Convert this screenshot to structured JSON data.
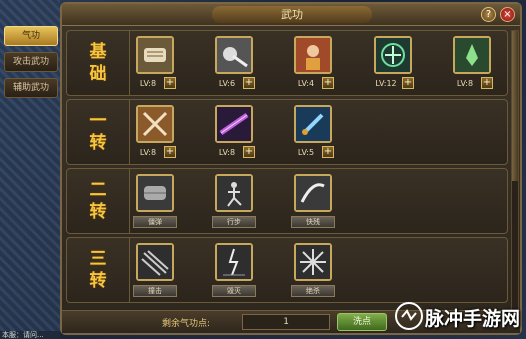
{
  "window": {
    "title": "武功"
  },
  "side_tabs": [
    {
      "label": "气功",
      "active": true
    },
    {
      "label": "攻击武功",
      "active": false
    },
    {
      "label": "辅助武功",
      "active": false
    }
  ],
  "tiers": [
    {
      "name": [
        "基",
        "础"
      ],
      "skills": [
        {
          "icon": "scroll-icon",
          "level": "LV:8",
          "type": "upgrade"
        },
        {
          "icon": "sword-hilt-icon",
          "level": "LV:6",
          "type": "upgrade"
        },
        {
          "icon": "warrior-portrait-icon",
          "level": "LV:4",
          "type": "upgrade"
        },
        {
          "icon": "green-aura-icon",
          "level": "LV:12",
          "type": "upgrade"
        },
        {
          "icon": "green-spirit-icon",
          "level": "LV:8",
          "type": "upgrade"
        }
      ]
    },
    {
      "name": [
        "一",
        "转"
      ],
      "skills": [
        {
          "icon": "crossed-blades-icon",
          "level": "LV:8",
          "type": "upgrade"
        },
        {
          "icon": "purple-blade-icon",
          "level": "LV:8",
          "type": "upgrade"
        },
        {
          "icon": "blue-dagger-icon",
          "level": "LV:5",
          "type": "upgrade"
        }
      ]
    },
    {
      "name": [
        "二",
        "转"
      ],
      "skills": [
        {
          "icon": "steel-gauntlet-icon",
          "name": "僵弹",
          "type": "locked"
        },
        {
          "icon": "martial-stance-icon",
          "name": "行步",
          "type": "locked"
        },
        {
          "icon": "swift-slash-icon",
          "name": "快残",
          "type": "locked"
        }
      ]
    },
    {
      "name": [
        "三",
        "转"
      ],
      "skills": [
        {
          "icon": "whirlwind-icon",
          "name": "撞击",
          "type": "locked"
        },
        {
          "icon": "lightning-burst-icon",
          "name": "毁灭",
          "type": "locked"
        },
        {
          "icon": "star-burst-icon",
          "name": "绝杀",
          "type": "locked"
        }
      ]
    }
  ],
  "plus_glyph": "+",
  "footer": {
    "remaining_label": "剩余气功点:",
    "remaining_value": "1",
    "wash_button": "洗点"
  },
  "header_icons": {
    "help": "?",
    "close": "×"
  },
  "bottom_text": "本服：请问...",
  "watermark": {
    "text": "脉冲手游网"
  },
  "colors": {
    "tier_gold": "#f5c640",
    "frame": "#c7a85c",
    "accent_green": "#7fae4a"
  }
}
